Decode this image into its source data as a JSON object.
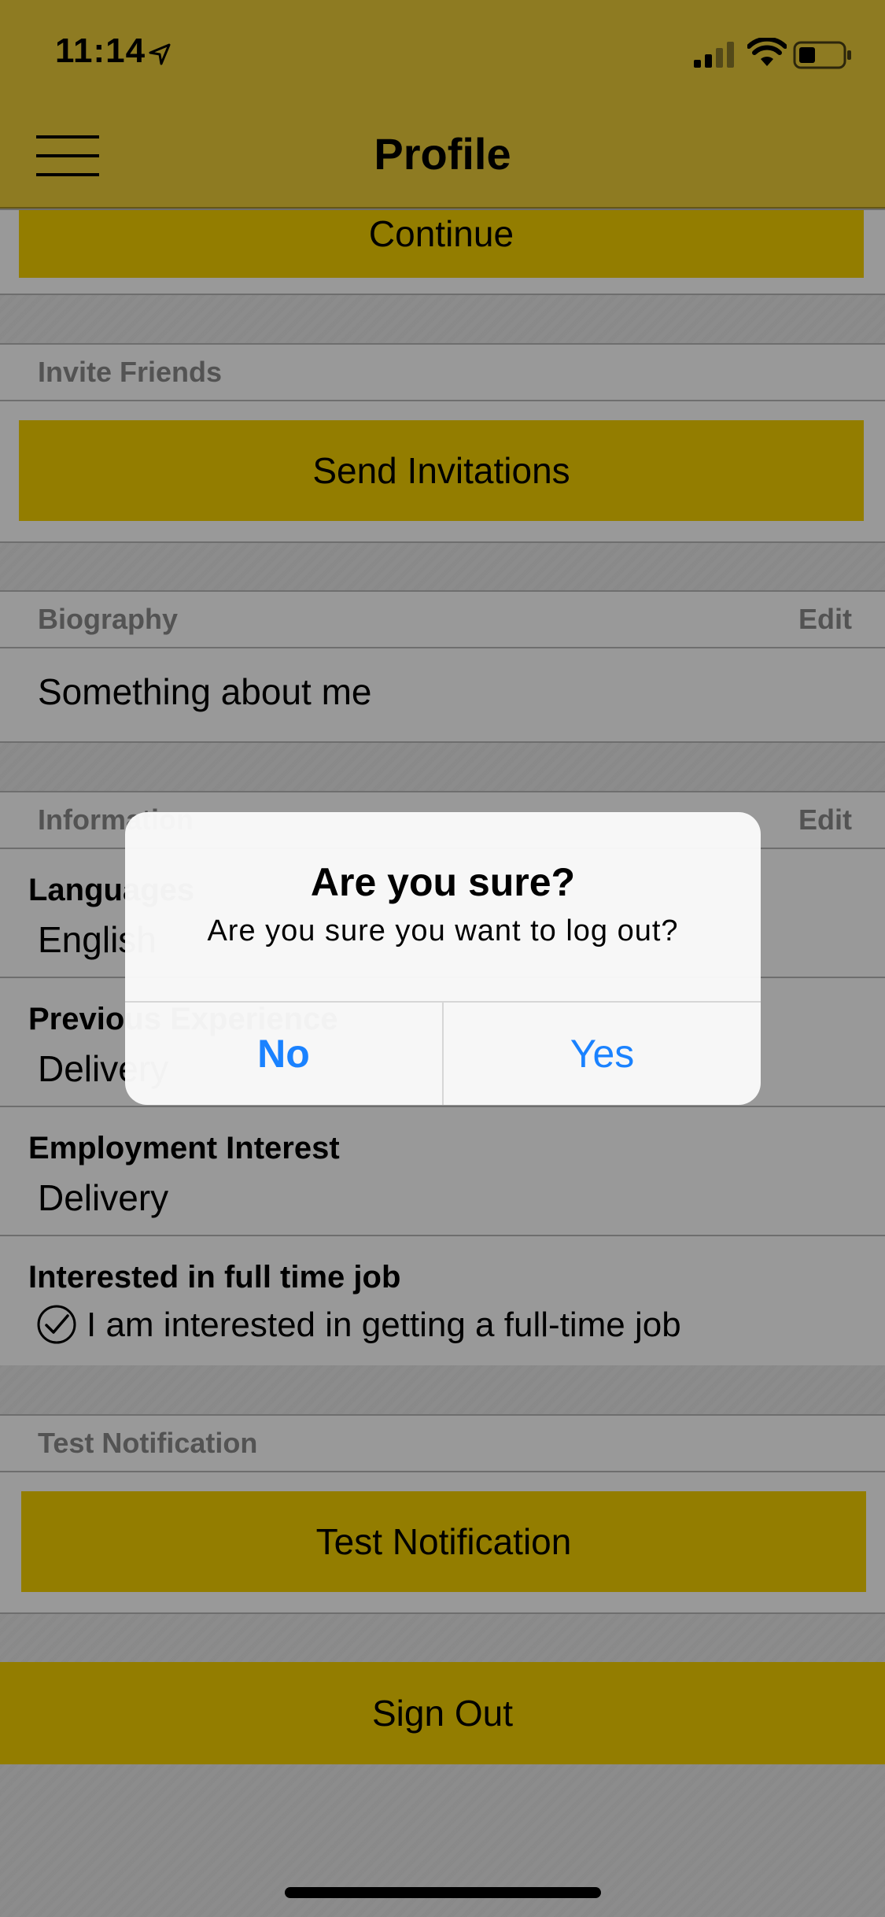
{
  "status_bar": {
    "time": "11:14"
  },
  "header": {
    "title": "Profile"
  },
  "sections": {
    "continue_button": "Continue",
    "invite": {
      "title": "Invite Friends",
      "button": "Send Invitations"
    },
    "biography": {
      "title": "Biography",
      "edit": "Edit",
      "text": "Something about me"
    },
    "information": {
      "title": "Information",
      "edit": "Edit",
      "rows": [
        {
          "label": "Languages",
          "value": "English"
        },
        {
          "label": "Previous Experience",
          "value": "Delivery"
        },
        {
          "label": "Employment Interest",
          "value": "Delivery"
        },
        {
          "label": "Interested in full time job",
          "value": "I am interested in getting a full-time job"
        }
      ]
    },
    "test_notification": {
      "title": "Test Notification",
      "button": "Test Notification"
    },
    "sign_out": "Sign Out"
  },
  "dialog": {
    "title": "Are you sure?",
    "message": "Are you sure you want to log out?",
    "no": "No",
    "yes": "Yes"
  },
  "colors": {
    "header": "#edcd3a",
    "button": "#f6d000",
    "dialog_action": "#1a82ff"
  }
}
